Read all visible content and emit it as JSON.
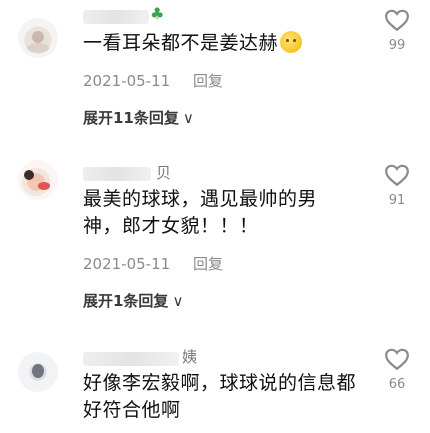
{
  "comments": [
    {
      "username_tail": "",
      "text": "一看耳朵都不是姜达赫",
      "date": "2021-05-11",
      "reply_label": "回复",
      "expand_label": "展开11条回复",
      "likes": "99",
      "emoji_icon": "flushed-face-icon"
    },
    {
      "username_tail": "贝",
      "text": "最美的球球，遇见最帅的男神，郎才女貌！！！",
      "date": "2021-05-11",
      "reply_label": "回复",
      "expand_label": "展开1条回复",
      "likes": "91"
    },
    {
      "username_tail": "姨",
      "text": "好像李宏毅啊，球球说的信息都好符合他啊",
      "likes": "66"
    }
  ],
  "icons": {
    "like": "heart-outline-icon",
    "expand": "chevron-down-icon",
    "badge": "clover-icon"
  },
  "colors": {
    "text": "#111111",
    "meta": "#8a8a8a",
    "badge": "#3fa34d"
  }
}
